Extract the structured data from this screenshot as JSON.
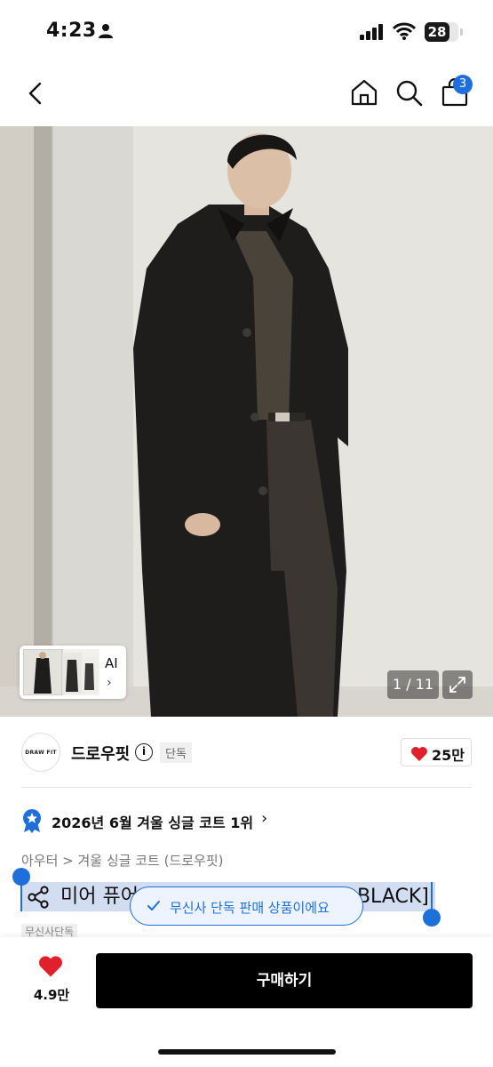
{
  "status_bar": {
    "time": "4:23",
    "battery": "28"
  },
  "nav": {
    "cart_count": "3"
  },
  "hero": {
    "ai_label": "AI",
    "page_indicator": "1 / 11"
  },
  "brand": {
    "logo_text": "DRAW FIT",
    "name": "드로우핏",
    "exclusive_tag": "단독",
    "like_count": "25만"
  },
  "ranking": {
    "text": "2026년 6월 겨울 싱글 코트 1위"
  },
  "breadcrumb": {
    "text": "아우터 > 겨울 싱글 코트 (드로우핏)"
  },
  "product": {
    "title_left": "미어 퓨어",
    "title_right": "BLACK]"
  },
  "toast": {
    "text": "무신사 단독 판매 상품이에요"
  },
  "partial_tag": {
    "text": "무신사단독"
  },
  "bottom_bar": {
    "like_count": "4.9만",
    "buy_label": "구매하기"
  },
  "colors": {
    "accent": "#1e6fd9",
    "heart": "#e0202b",
    "buy_button": "#000000"
  }
}
